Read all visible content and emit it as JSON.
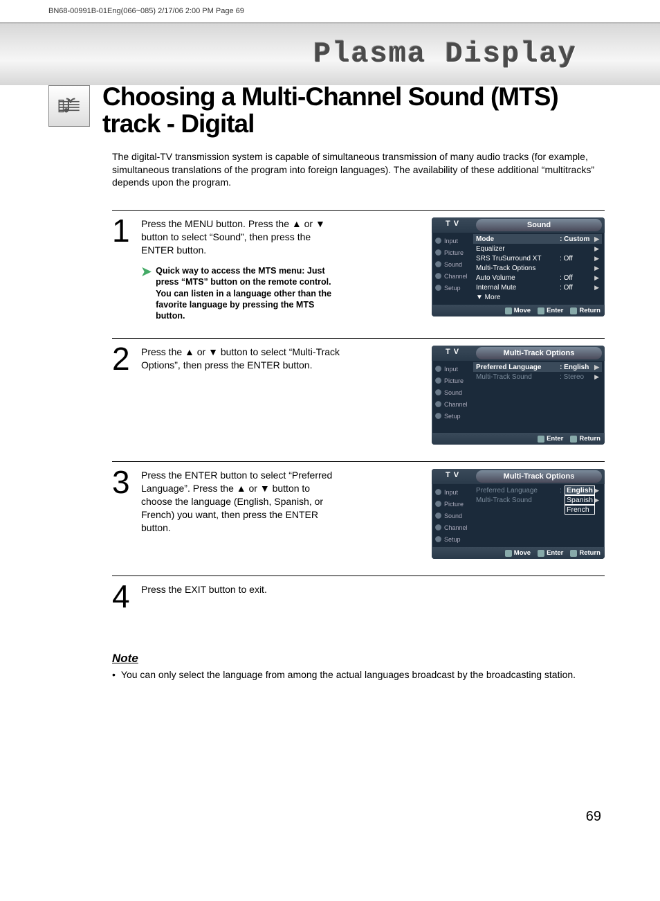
{
  "header_text": "BN68-00991B-01Eng(066~085)  2/17/06  2:00 PM  Page 69",
  "banner_title": "Plasma Display",
  "page_title": "Choosing a Multi-Channel Sound (MTS) track - Digital",
  "intro": "The digital-TV transmission system is capable of simultaneous transmission of many audio tracks (for example, simultaneous translations of the program into foreign languages). The availability of these additional “multitracks” depends upon the program.",
  "steps": {
    "s1": {
      "num": "1",
      "text": "Press the MENU button. Press the ▲ or ▼ button to select “Sound”, then press the ENTER button.",
      "tip": "Quick way to access the MTS menu: Just press “MTS” button on the remote control. You can listen in a language other than the favorite language by pressing the MTS button."
    },
    "s2": {
      "num": "2",
      "text": "Press the ▲ or ▼ button to select “Multi-Track Options”, then press the ENTER button."
    },
    "s3": {
      "num": "3",
      "text": "Press the ENTER button to select “Preferred Language”. Press the ▲ or ▼ button to choose the language (English, Spanish, or French) you want, then press the ENTER button."
    },
    "s4": {
      "num": "4",
      "text": "Press the EXIT button to exit."
    }
  },
  "note_label": "Note",
  "note_text": "You can only select the language from among the actual languages broadcast by the broadcasting station.",
  "page_number": "69",
  "osd_common": {
    "tv": "T V",
    "side": [
      "Input",
      "Picture",
      "Sound",
      "Channel",
      "Setup"
    ],
    "move": "Move",
    "enter": "Enter",
    "return": "Return"
  },
  "osd1": {
    "tab": "Sound",
    "rows": [
      {
        "label": "Mode",
        "value": ": Custom",
        "hl": true
      },
      {
        "label": "Equalizer",
        "value": ""
      },
      {
        "label": "SRS TruSurround XT",
        "value": ": Off"
      },
      {
        "label": "Multi-Track Options",
        "value": ""
      },
      {
        "label": "Auto Volume",
        "value": ": Off"
      },
      {
        "label": "Internal Mute",
        "value": ": Off"
      },
      {
        "label": "▼ More",
        "value": "",
        "noarr": true
      }
    ]
  },
  "osd2": {
    "tab": "Multi-Track Options",
    "rows": [
      {
        "label": "Preferred Language",
        "value": ": English",
        "hl": true
      },
      {
        "label": "Multi-Track Sound",
        "value": ": Stereo",
        "dim": true
      }
    ]
  },
  "osd3": {
    "tab": "Multi-Track Options",
    "rows": [
      {
        "label": "Preferred Language",
        "value": ":",
        "dim": true
      },
      {
        "label": "Multi-Track Sound",
        "value": "",
        "dim": true
      }
    ],
    "popup": [
      "English",
      "Spanish",
      "French"
    ]
  }
}
